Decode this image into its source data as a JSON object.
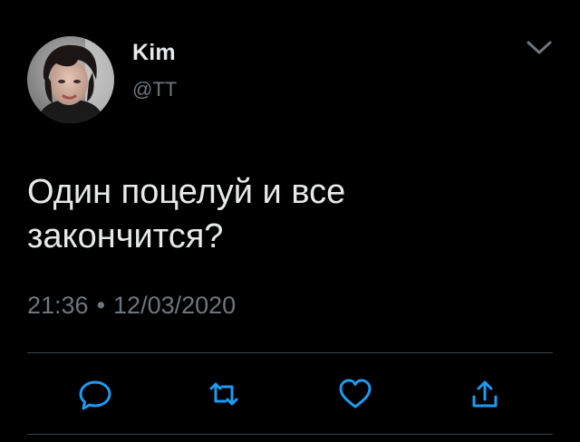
{
  "tweet": {
    "author": {
      "display_name": "Kim",
      "handle": "@TT"
    },
    "text": "Один поцелуй и все\nзакончится?",
    "time": "21:36",
    "separator": "•",
    "date": "12/03/2020"
  },
  "actions": {
    "reply_icon": "reply-icon",
    "retweet_icon": "retweet-icon",
    "like_icon": "heart-icon",
    "share_icon": "share-icon"
  },
  "colors": {
    "background": "#000000",
    "text": "#e7e9ea",
    "secondary": "#6e767d",
    "icon": "#1d9bf0",
    "divider": "#38444d"
  }
}
